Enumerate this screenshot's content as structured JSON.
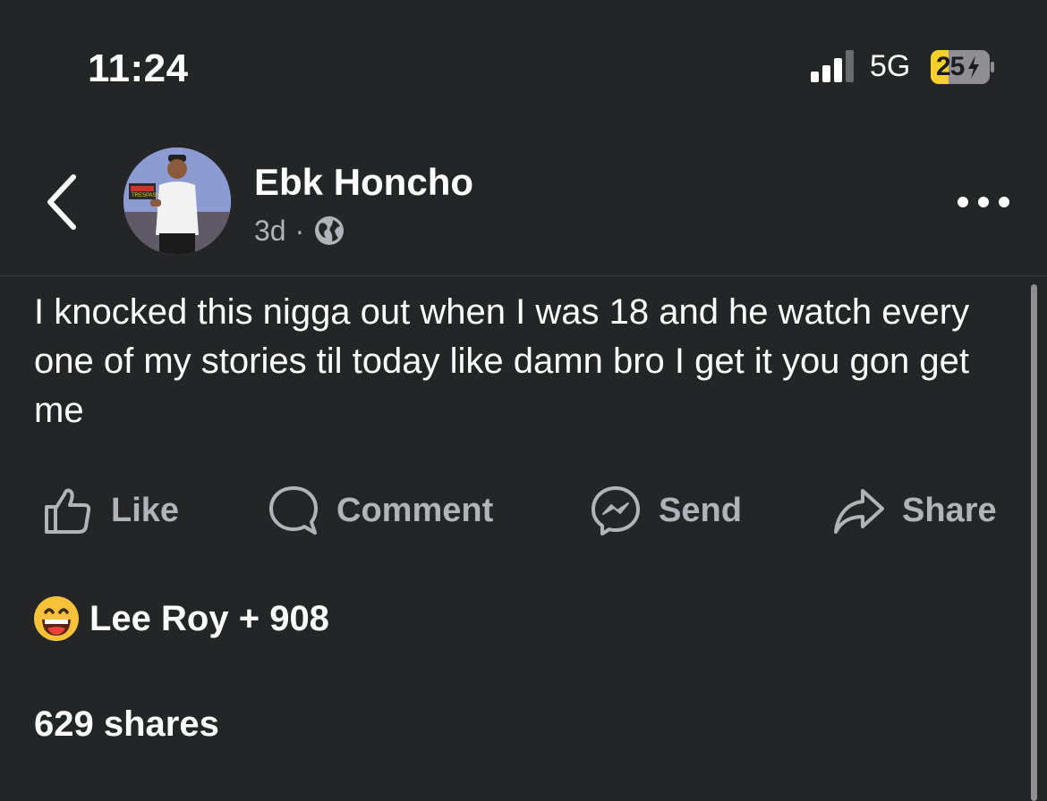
{
  "status_bar": {
    "time": "11:24",
    "network": "5G",
    "battery": "25",
    "battery_color": "#f5cf2c"
  },
  "post": {
    "author": "Ebk Honcho",
    "age": "3d",
    "separator": "·",
    "privacy_icon": "globe-icon",
    "text": "I knocked this nigga out when I was 18 and he watch every one of my stories til today like damn bro I get it you gon get me",
    "avatar_sign_text": "TRESPASS"
  },
  "actions": {
    "like_label": "Like",
    "comment_label": "Comment",
    "send_label": "Send",
    "share_label": "Share"
  },
  "reactions": {
    "icon": "laughing-face-icon",
    "summary": "Lee Roy + 908"
  },
  "stats": {
    "shares": "629 shares"
  },
  "colors": {
    "background": "#242526",
    "primary_text": "#ffffff",
    "secondary_text": "#b0b3b8"
  }
}
